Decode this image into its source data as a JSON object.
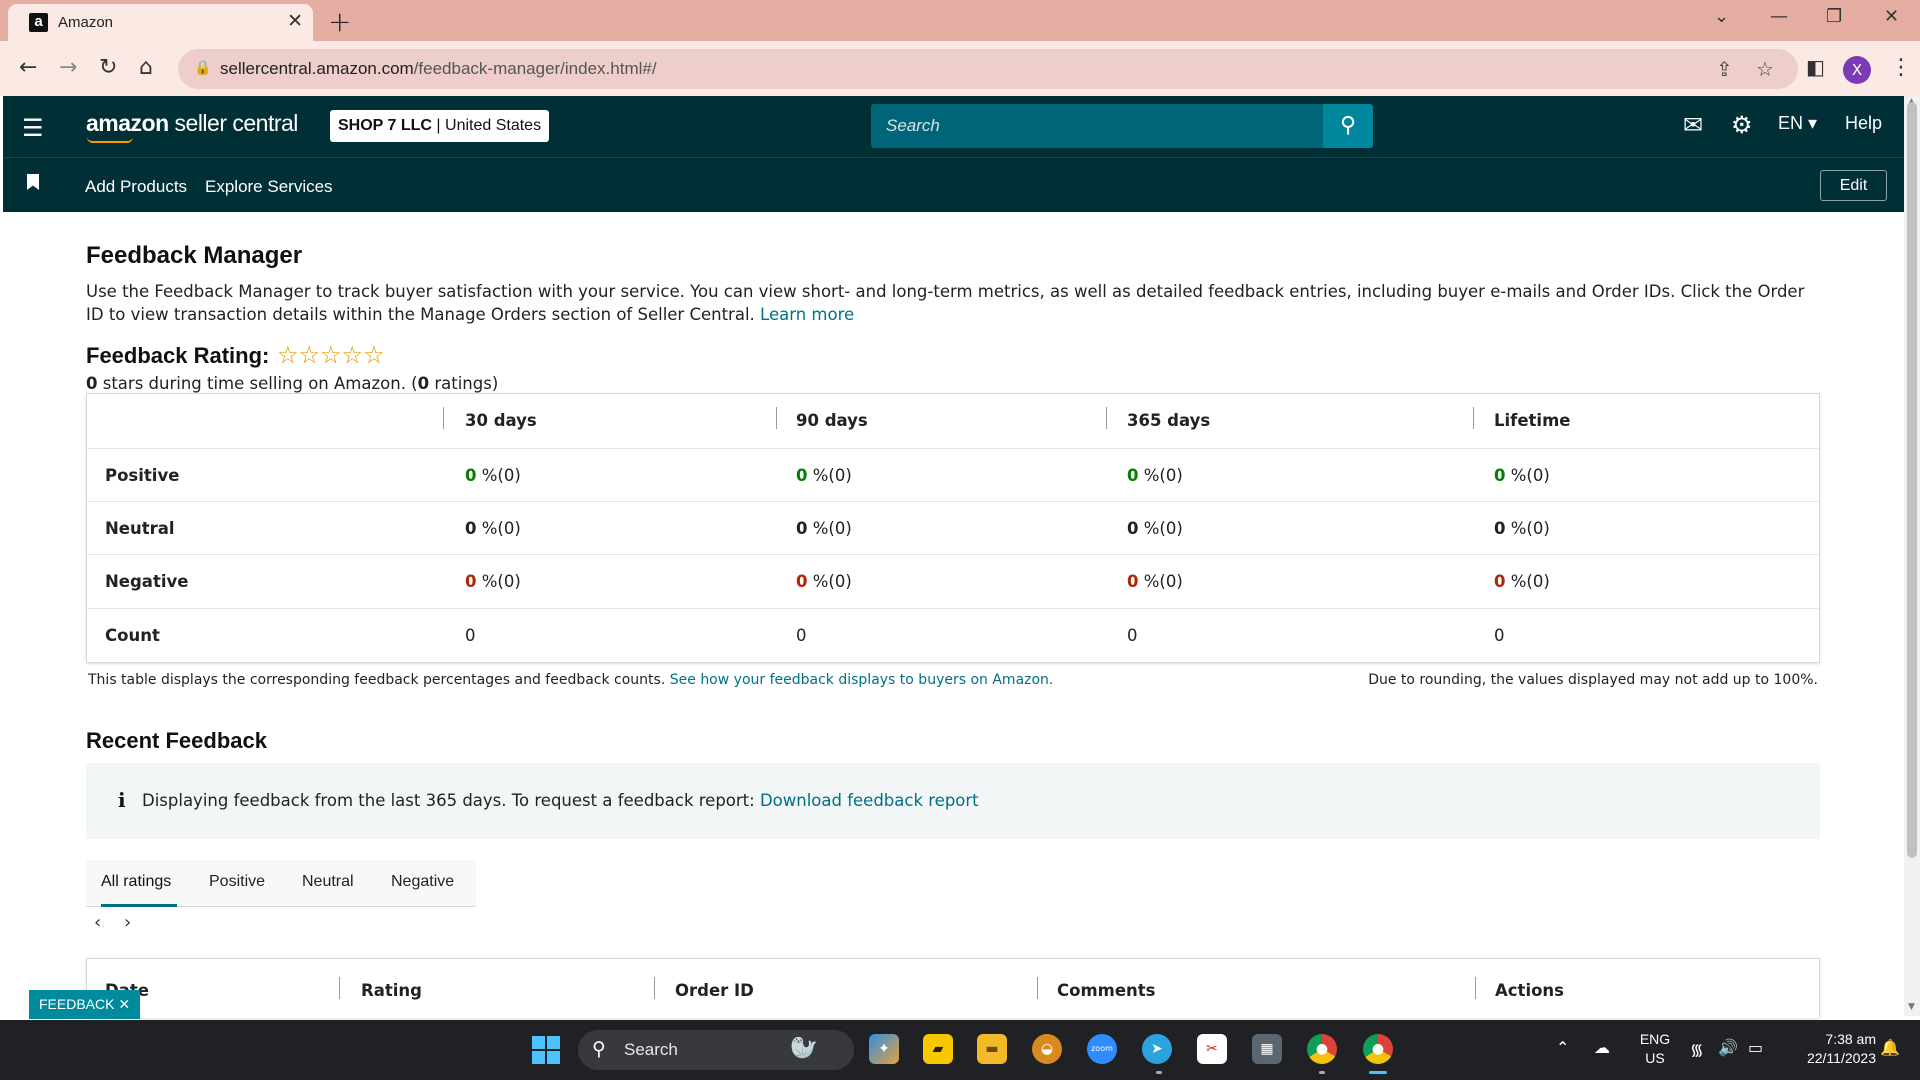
{
  "browser": {
    "tab_title": "Amazon",
    "url_host": "sellercentral.amazon.com",
    "url_path": "/feedback-manager/index.html#/",
    "profile_initial": "X"
  },
  "header": {
    "logo_main": "amazon",
    "logo_sub": "seller central",
    "account_shop": "SHOP 7 LLC",
    "account_region": "| United States",
    "search_placeholder": "Search",
    "language": "EN",
    "help": "Help"
  },
  "subnav": {
    "links": [
      "Add Products",
      "Explore Services"
    ],
    "edit": "Edit"
  },
  "page": {
    "title": "Feedback Manager",
    "intro": "Use the Feedback Manager to track buyer satisfaction with your service. You can view short- and long-term metrics, as well as detailed feedback entries, including buyer e-mails and Order IDs. Click the Order ID to view transaction details within the Manage Orders section of Seller Central.",
    "learn_more": "Learn more",
    "rating_title": "Feedback Rating:",
    "stars": "☆☆☆☆☆",
    "star_rating": 0,
    "rating_sub_a": "0",
    "rating_sub_b": " stars during time selling on Amazon. (",
    "rating_sub_c": "0",
    "rating_sub_d": " ratings)"
  },
  "feedback_table": {
    "columns": [
      "30 days",
      "90 days",
      "365 days",
      "Lifetime"
    ],
    "rows": [
      {
        "label": "Positive",
        "values": [
          "0",
          "0",
          "0",
          "0"
        ],
        "suffix": " %(0)"
      },
      {
        "label": "Neutral",
        "values": [
          "0",
          "0",
          "0",
          "0"
        ],
        "suffix": " %(0)"
      },
      {
        "label": "Negative",
        "values": [
          "0",
          "0",
          "0",
          "0"
        ],
        "suffix": " %(0)"
      },
      {
        "label": "Count",
        "values": [
          "0",
          "0",
          "0",
          "0"
        ],
        "suffix": ""
      }
    ],
    "note": "This table displays the corresponding feedback percentages and feedback counts.",
    "note_link": "See how your feedback displays to buyers on Amazon.",
    "note_right": "Due to rounding, the values displayed may not add up to 100%."
  },
  "recent": {
    "title": "Recent Feedback",
    "info_icon": "i",
    "info_text": "Displaying feedback from the last 365 days. To request a feedback report:",
    "info_link": "Download feedback report",
    "tabs": [
      "All ratings",
      "Positive",
      "Neutral",
      "Negative"
    ],
    "active_tab": "All ratings",
    "list_columns": [
      "Date",
      "Rating",
      "Order ID",
      "Comments",
      "Actions"
    ]
  },
  "feedback_badge": "FEEDBACK ✕",
  "taskbar": {
    "search": "Search",
    "lang_line1": "ENG",
    "lang_line2": "US",
    "time": "7:38 am",
    "date": "22/11/2023"
  },
  "colors": {
    "header_bg": "#002f36",
    "link": "#007185",
    "positive": "#067d06",
    "negative": "#b12704",
    "star": "#e29500"
  }
}
